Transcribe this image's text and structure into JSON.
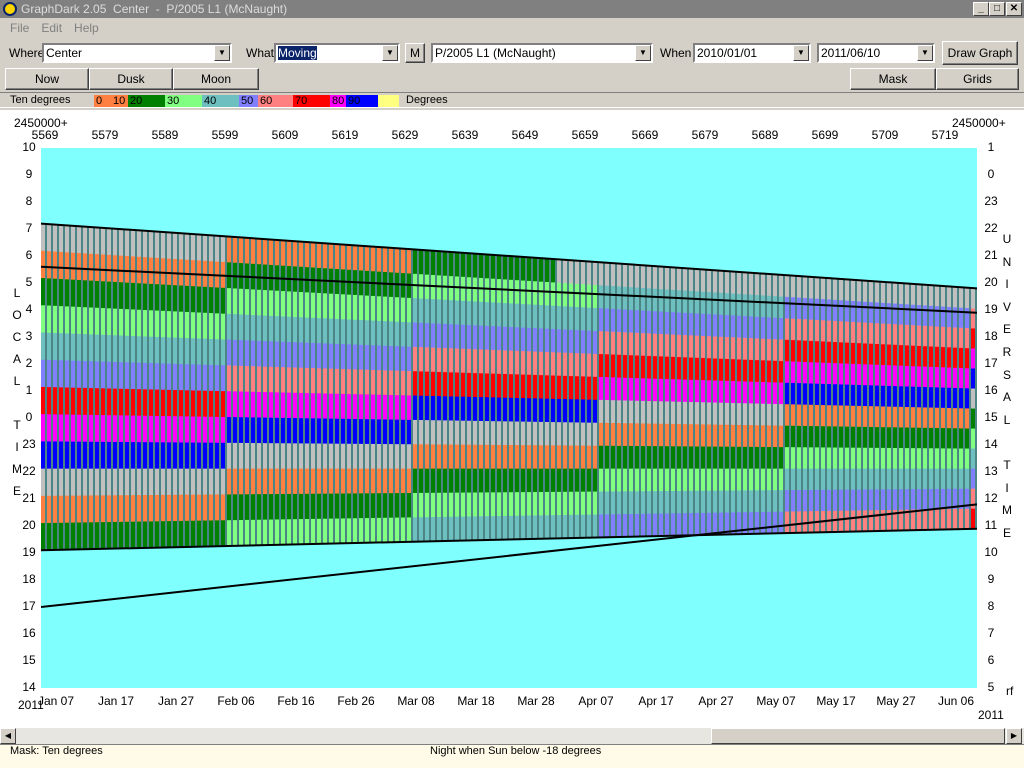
{
  "window": {
    "title": "GraphDark 2.05  Center  -  P/2005 L1 (McNaught)",
    "min": "_",
    "max": "□",
    "close": "✕"
  },
  "menu": [
    "File",
    "Edit",
    "Help"
  ],
  "toolbar": {
    "where_label": "Where",
    "where_value": "Center",
    "what_label": "What",
    "what_value": "Moving",
    "m_button": "M",
    "object_value": "P/2005 L1 (McNaught)",
    "when_label": "When",
    "from_date": "2010/01/01",
    "to_date": "2011/06/10",
    "draw_graph": "Draw Graph"
  },
  "buttons": {
    "now": "Now",
    "dusk": "Dusk",
    "moon": "Moon",
    "mask": "Mask",
    "grids": "Grids"
  },
  "legend": {
    "title": "Ten degrees",
    "units": "Degrees",
    "items": [
      {
        "label": "0",
        "color": "#ff8040"
      },
      {
        "label": "10",
        "color": "#ff8040"
      },
      {
        "label": "20",
        "color": "#008000"
      },
      {
        "label": "30",
        "color": "#80ff80"
      },
      {
        "label": "40",
        "color": "#6ec0c0"
      },
      {
        "label": "50",
        "color": "#8080ff"
      },
      {
        "label": "60",
        "color": "#ff8080"
      },
      {
        "label": "70",
        "color": "#ff0000"
      },
      {
        "label": "80",
        "color": "#ff00ff"
      },
      {
        "label": "90",
        "color": "#0000ff"
      },
      {
        "label": "",
        "color": "#ffff80"
      }
    ]
  },
  "chart_data": {
    "type": "heatmap",
    "jd_prefix_left": "2450000+",
    "jd_prefix_right": "2450000+",
    "jd_ticks": [
      "5569",
      "5579",
      "5589",
      "5599",
      "5609",
      "5619",
      "5629",
      "5639",
      "5649",
      "5659",
      "5669",
      "5679",
      "5689",
      "5699",
      "5709",
      "5719"
    ],
    "date_ticks": [
      "Jan 07",
      "Jan 17",
      "Jan 27",
      "Feb 06",
      "Feb 16",
      "Feb 26",
      "Mar 08",
      "Mar 18",
      "Mar 28",
      "Apr 07",
      "Apr 17",
      "Apr 27",
      "May 07",
      "May 17",
      "May 27",
      "Jun 06"
    ],
    "year_left": "2011",
    "year_right": "2011",
    "corner_right": "rf",
    "left_ticks": [
      "10",
      "9",
      "8",
      "7",
      "6",
      "5",
      "4",
      "3",
      "2",
      "1",
      "0",
      "23",
      "22",
      "21",
      "20",
      "19",
      "18",
      "17",
      "16",
      "15",
      "14"
    ],
    "right_ticks": [
      "1",
      "0",
      "23",
      "22",
      "21",
      "20",
      "19",
      "18",
      "17",
      "16",
      "15",
      "14",
      "13",
      "12",
      "11",
      "10",
      "9",
      "8",
      "7",
      "6",
      "5"
    ],
    "left_label": [
      "L",
      "O",
      "C",
      "A",
      "L",
      "",
      "T",
      "I",
      "M",
      "E"
    ],
    "right_label": [
      "U",
      "N",
      "I",
      "V",
      "E",
      "R",
      "S",
      "A",
      "L",
      "",
      "T",
      "I",
      "M",
      "E"
    ],
    "ylim_local": [
      14,
      10
    ],
    "night_start_local": [
      19.1,
      19.9
    ],
    "night_end_local": [
      7.2,
      4.8
    ],
    "dark_limit_start": [
      17.0,
      20.8
    ],
    "dark_limit_end": [
      5.6,
      3.9
    ],
    "color_bands_deg": [
      0,
      10,
      20,
      30,
      40,
      50,
      60,
      70,
      80
    ]
  },
  "status": {
    "mask": "Mask:  Ten degrees",
    "night": "Night when Sun below -18 degrees"
  }
}
